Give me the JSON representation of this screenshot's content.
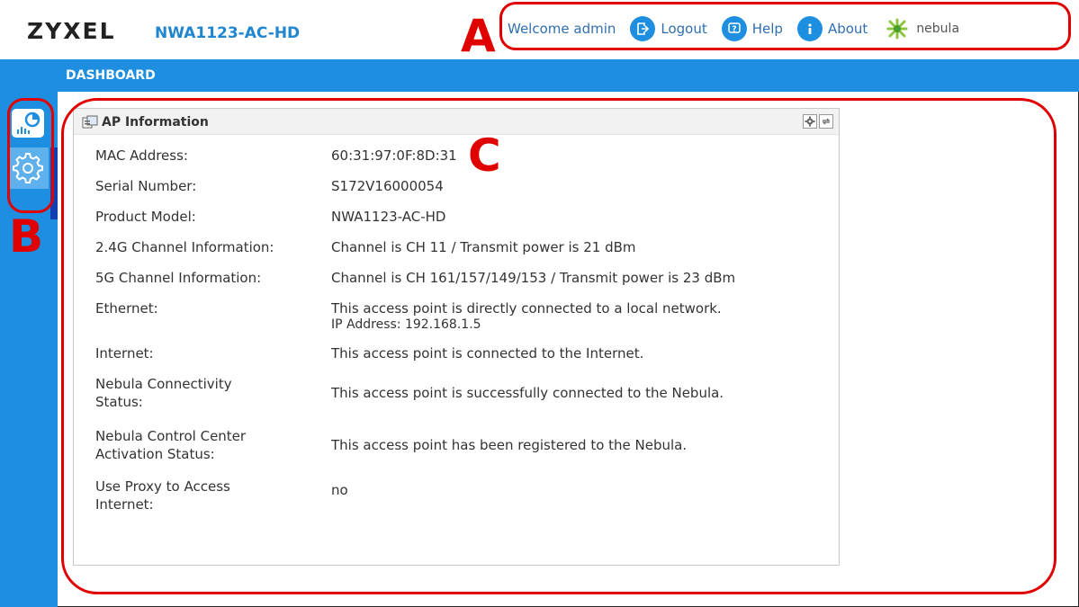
{
  "header": {
    "brand": "ZYXEL",
    "model": "NWA1123-AC-HD",
    "welcome": "Welcome admin",
    "logout_label": "Logout",
    "help_label": "Help",
    "about_label": "About",
    "nebula_label": "nebula"
  },
  "topbar": {
    "title": "DASHBOARD"
  },
  "sidebar": {
    "items": [
      {
        "icon": "dashboard-chart-icon"
      },
      {
        "icon": "gear-icon"
      }
    ]
  },
  "panel": {
    "title": "AP Information",
    "rows": [
      {
        "label": "MAC Address:",
        "value": "60:31:97:0F:8D:31"
      },
      {
        "label": "Serial Number:",
        "value": "S172V16000054"
      },
      {
        "label": "Product Model:",
        "value": "NWA1123-AC-HD"
      },
      {
        "label": "2.4G Channel Information:",
        "value": "Channel is CH 11 / Transmit power is 21 dBm"
      },
      {
        "label": "5G Channel Information:",
        "value": "Channel is CH 161/157/149/153 / Transmit power is 23 dBm"
      },
      {
        "label": "Ethernet:",
        "value": "This access point is directly connected to a local network.",
        "value2": "IP Address: 192.168.1.5"
      },
      {
        "label": "Internet:",
        "value": "This access point is connected to the Internet."
      },
      {
        "label": "Nebula Connectivity Status:",
        "value": "This access point is successfully connected to the Nebula."
      },
      {
        "label": "Nebula Control Center Activation Status:",
        "value": "This access point has been registered to the Nebula."
      },
      {
        "label": "Use Proxy to Access Internet:",
        "value": "no"
      }
    ]
  },
  "annotations": {
    "a": "A",
    "b": "B",
    "c": "C"
  },
  "colors": {
    "accent": "#1e8fe0",
    "annotation": "#e00000",
    "model_text": "#1f86cf"
  }
}
